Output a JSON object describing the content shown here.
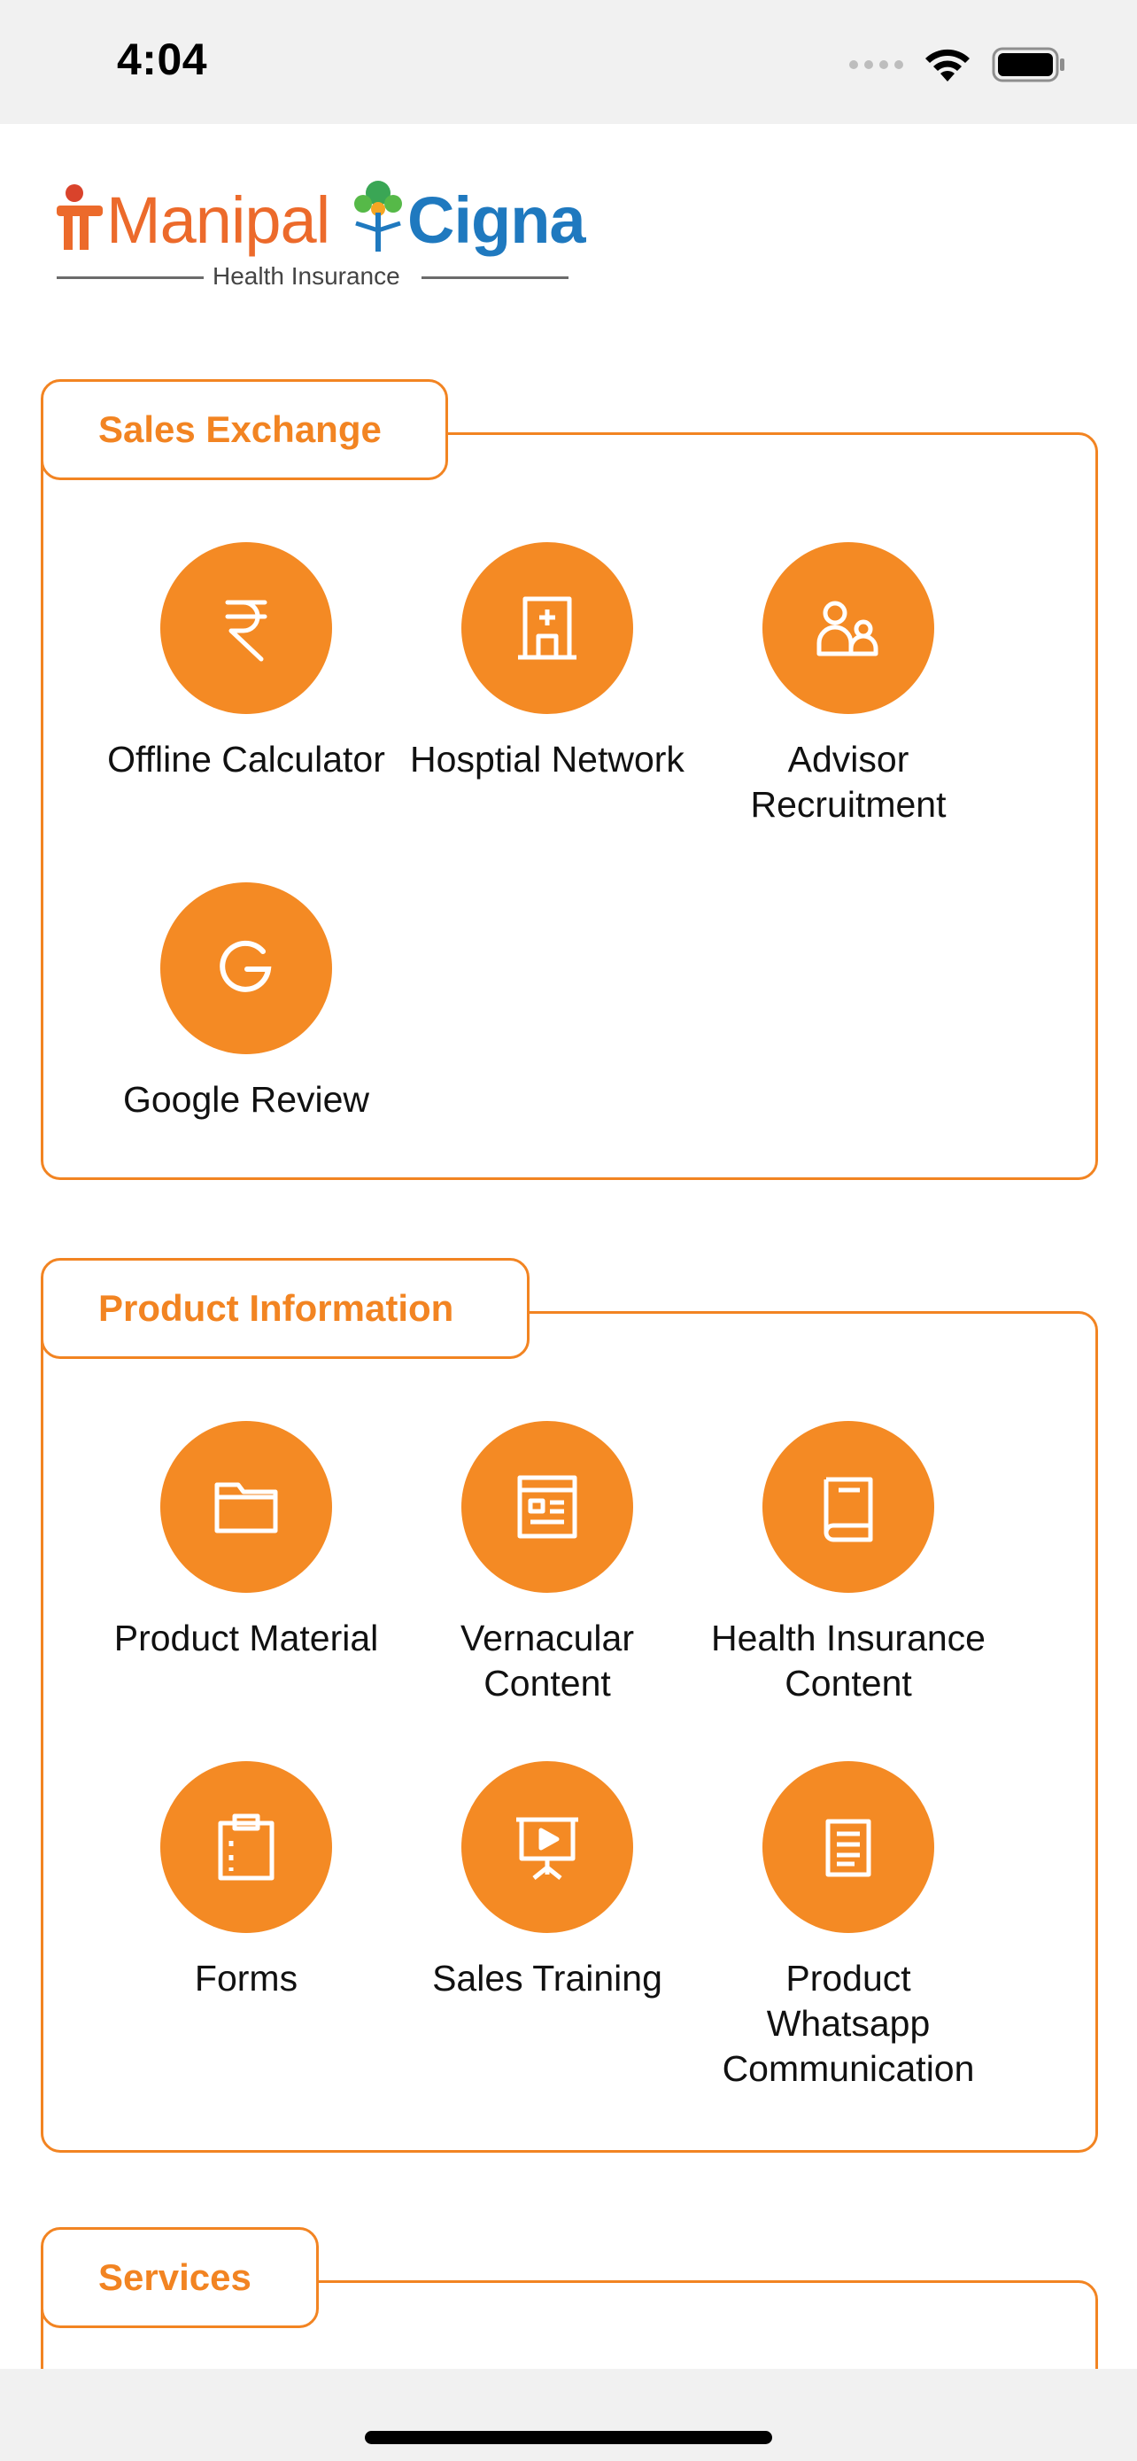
{
  "status_bar": {
    "time": "4:04"
  },
  "logo": {
    "brand_left": "Manipal",
    "brand_right": "Cigna",
    "subtitle": "Health Insurance"
  },
  "colors": {
    "accent": "#f28422",
    "icon_circle": "#f48a24",
    "logo_orange": "#ec6a2b",
    "logo_blue": "#1f79bf"
  },
  "sections": [
    {
      "title": "Sales Exchange",
      "items": [
        {
          "label": "Offline Calculator",
          "icon": "rupee-icon"
        },
        {
          "label": "Hosptial Network",
          "icon": "hospital-icon"
        },
        {
          "label": "Advisor\nRecruitment",
          "icon": "people-icon"
        },
        {
          "label": "Google Review",
          "icon": "google-icon"
        }
      ]
    },
    {
      "title": "Product Information",
      "items": [
        {
          "label": "Product Material",
          "icon": "folder-icon"
        },
        {
          "label": "Vernacular\nContent",
          "icon": "newspaper-icon"
        },
        {
          "label": "Health Insurance\nContent",
          "icon": "book-icon"
        },
        {
          "label": "Forms",
          "icon": "clipboard-icon"
        },
        {
          "label": "Sales Training",
          "icon": "presentation-icon"
        },
        {
          "label": "Product\nWhatsapp\nCommunication",
          "icon": "document-icon"
        }
      ]
    },
    {
      "title": "Services",
      "items": []
    }
  ]
}
